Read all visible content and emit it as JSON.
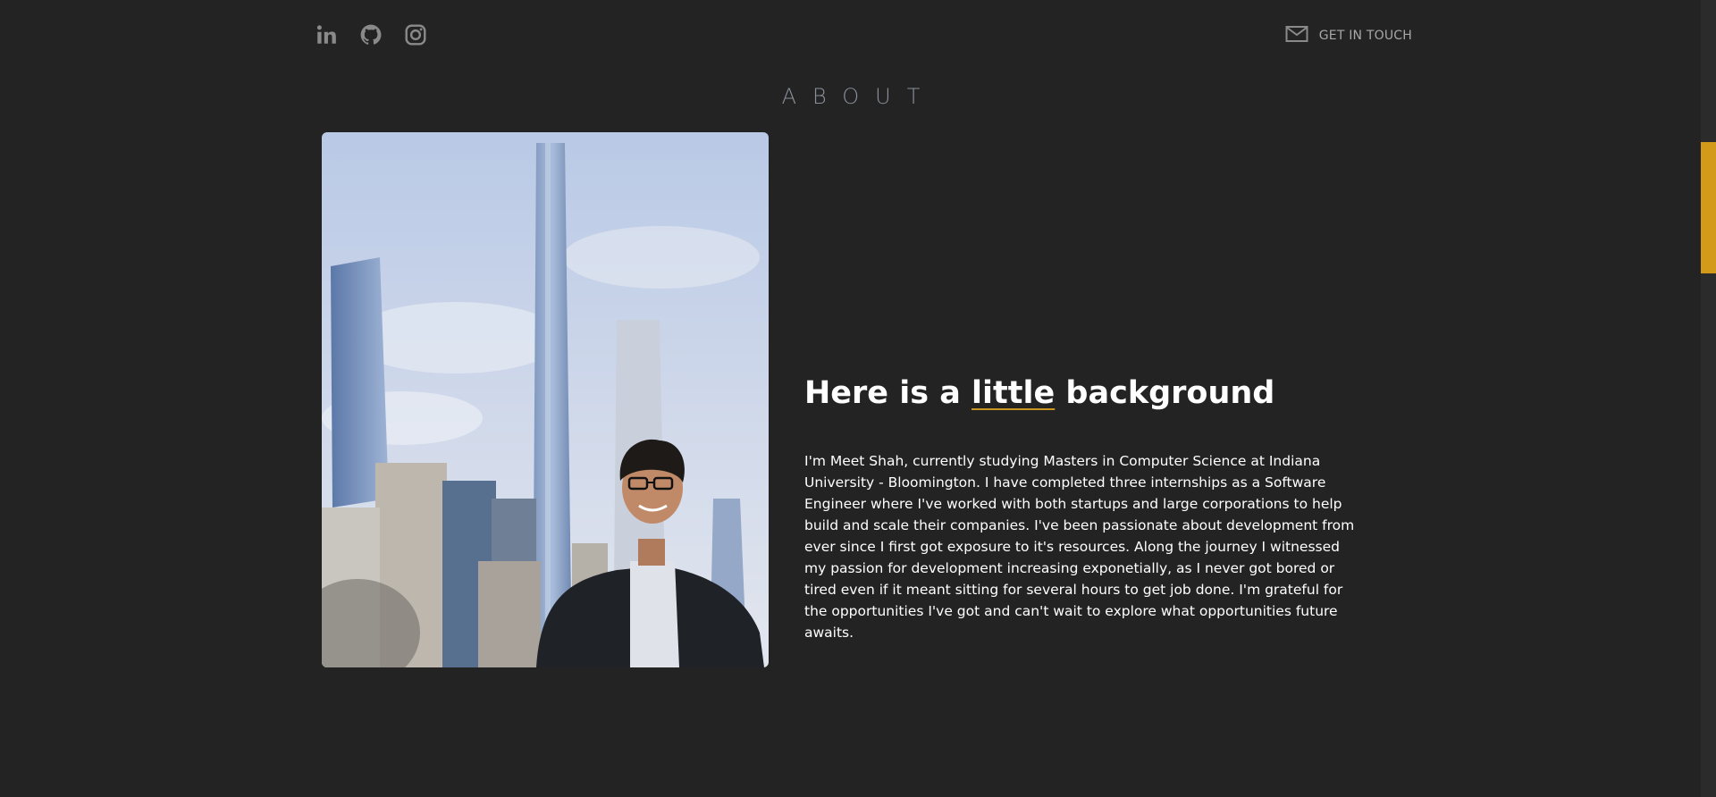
{
  "header": {
    "social_links": [
      {
        "icon": "linkedin-icon"
      },
      {
        "icon": "github-icon"
      },
      {
        "icon": "instagram-icon"
      }
    ],
    "contact_label": "GET IN TOUCH",
    "contact_icon": "mail-icon"
  },
  "section": {
    "title": "ABOUT"
  },
  "about": {
    "headline_pre": "Here is a ",
    "headline_emph": "little",
    "headline_post": " background",
    "bio": "I'm Meet Shah, currently studying Masters in Computer Science at Indiana University - Bloomington. I have completed three internships as a Software Engineer where I've worked with both startups and large corporations to help build and scale their companies. I've been passionate about development from ever since I first got exposure to it's resources. Along the journey I witnessed my passion for development increasing exponetially, as I never got bored or tired even if it meant sitting for several hours to get job done. I'm grateful for the opportunities I've got and can't wait to explore what opportunities future awaits."
  },
  "colors": {
    "background": "#232323",
    "accent": "#d39a1a",
    "text": "#ffffff",
    "muted": "#a7a7a7"
  }
}
